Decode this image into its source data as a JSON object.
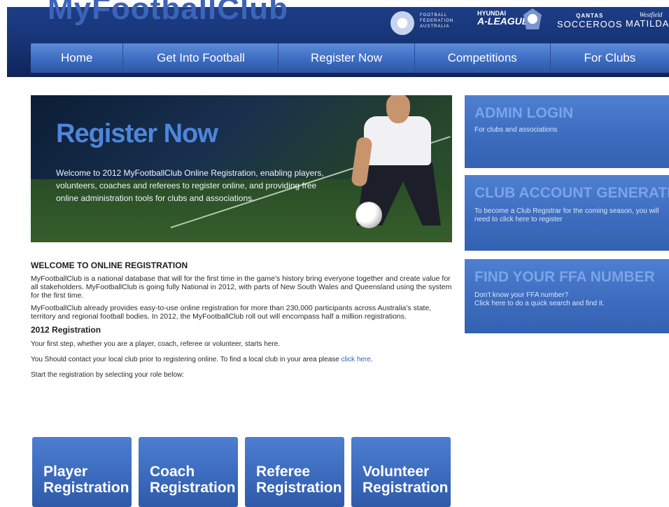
{
  "header": {
    "site_logo": "MyFootballClub",
    "partners": {
      "ffa_line1": "FOOTBALL",
      "ffa_line2": "FEDERATION",
      "ffa_line3": "AUSTRALIA",
      "aleague_line1": "HYUNDAI",
      "aleague_line2": "A-LEAGUE",
      "socceroos_sponsor": "QANTAS",
      "socceroos_name": "SOCCEROOS",
      "matildas_sponsor": "Westfield",
      "matildas_name": "MATILDAS"
    }
  },
  "nav": {
    "items": [
      "Home",
      "Get Into Football",
      "Register Now",
      "Competitions",
      "For Clubs"
    ]
  },
  "hero": {
    "title": "Register Now",
    "text": "Welcome to 2012 MyFootballClub Online Registration, enabling players, volunteers, coaches and referees to register online, and providing free online administration tools for clubs and associations."
  },
  "sidebar": {
    "admin": {
      "title": "ADMIN LOGIN",
      "text": "For clubs and associations"
    },
    "club": {
      "title": "CLUB ACCOUNT GENERATION",
      "text": "To become a Club Registrar for the coming season, you will need to click here to register"
    },
    "ffa": {
      "title": "FIND YOUR FFA NUMBER",
      "text1": "Don't know your FFA number?",
      "text2": "Click here to do a quick search and find it."
    }
  },
  "content": {
    "heading": "WELCOME TO ONLINE REGISTRATION",
    "para1": "MyFootballClub is a national database that will for the first time in the game's history bring everyone together and create value for all stakeholders. MyFootballClub is going fully National in 2012, with parts of New South Wales and Queensland using the system for the first time.",
    "para2": "MyFootballClub already provides easy-to-use online registration for more than 230,000 participants across Australia's state, territory and regional football bodies. In 2012, the MyFootballClub roll out will encompass half a million registrations.",
    "subheading": "2012 Registration",
    "step": "Your first step, whether you are a player, coach, referee or volunteer, starts here.",
    "contact_prefix": "You Should contact your local club prior to registering online. To find a local club in your area please ",
    "contact_link": "click here",
    "contact_suffix": ".",
    "start": "Start the registration by selecting your role below:"
  },
  "roles": [
    {
      "line1": "Player",
      "line2": "Registration"
    },
    {
      "line1": "Coach",
      "line2": "Registration"
    },
    {
      "line1": "Referee",
      "line2": "Registration"
    },
    {
      "line1": "Volunteer",
      "line2": "Registration"
    }
  ],
  "colors": {
    "header_bg": "#163374",
    "nav_bg": "#3d6cc1",
    "tile_bg": "#3a69bb",
    "link": "#2f64c4"
  }
}
